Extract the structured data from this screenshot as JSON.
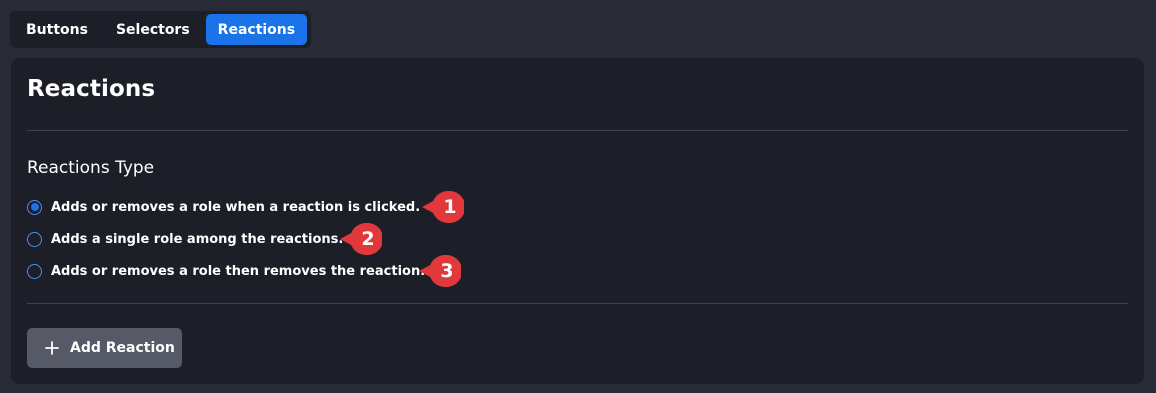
{
  "tabs": [
    {
      "label": "Buttons",
      "active": false
    },
    {
      "label": "Selectors",
      "active": false
    },
    {
      "label": "Reactions",
      "active": true
    }
  ],
  "card": {
    "title": "Reactions",
    "section_label": "Reactions Type",
    "options": [
      {
        "label": "Adds or removes a role when a reaction is clicked.",
        "selected": true
      },
      {
        "label": "Adds a single role among the reactions.",
        "selected": false
      },
      {
        "label": "Adds or removes a role then removes the reaction.",
        "selected": false
      }
    ],
    "add_button": {
      "label": "Add Reaction",
      "icon": "plus-icon"
    }
  },
  "callouts": [
    "1",
    "2",
    "3"
  ],
  "colors": {
    "background": "#282b36",
    "card": "#1c1e28",
    "accent": "#1a73e8",
    "callout": "#e0383b",
    "button": "#555a66"
  }
}
